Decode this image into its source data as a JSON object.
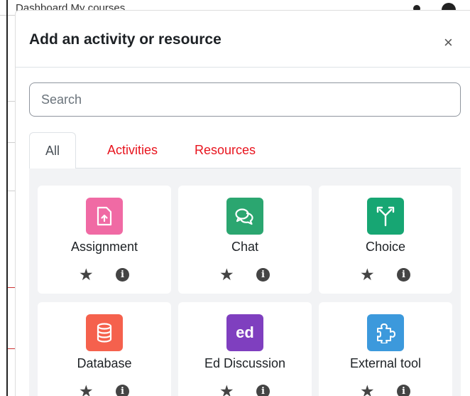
{
  "background": {
    "breadcrumb": "Dashboard    My courses"
  },
  "modal": {
    "title": "Add an activity or resource",
    "close_label": "×"
  },
  "search": {
    "placeholder": "Search"
  },
  "tabs": [
    {
      "label": "All",
      "active": true
    },
    {
      "label": "Activities",
      "active": false
    },
    {
      "label": "Resources",
      "active": false
    }
  ],
  "modules": [
    {
      "name": "Assignment",
      "icon": "assignment-icon",
      "color": "#f06aa4"
    },
    {
      "name": "Chat",
      "icon": "chat-icon",
      "color": "#2ba670"
    },
    {
      "name": "Choice",
      "icon": "choice-icon",
      "color": "#17a673"
    },
    {
      "name": "Database",
      "icon": "database-icon",
      "color": "#f5614d"
    },
    {
      "name": "Ed Discussion",
      "icon": "ed-discussion-icon",
      "icon_text": "ed",
      "color": "#7f3fbf"
    },
    {
      "name": "External tool",
      "icon": "puzzle-icon",
      "color": "#3c99dc"
    }
  ],
  "card_actions": {
    "star_glyph": "★",
    "info_glyph": "i"
  }
}
